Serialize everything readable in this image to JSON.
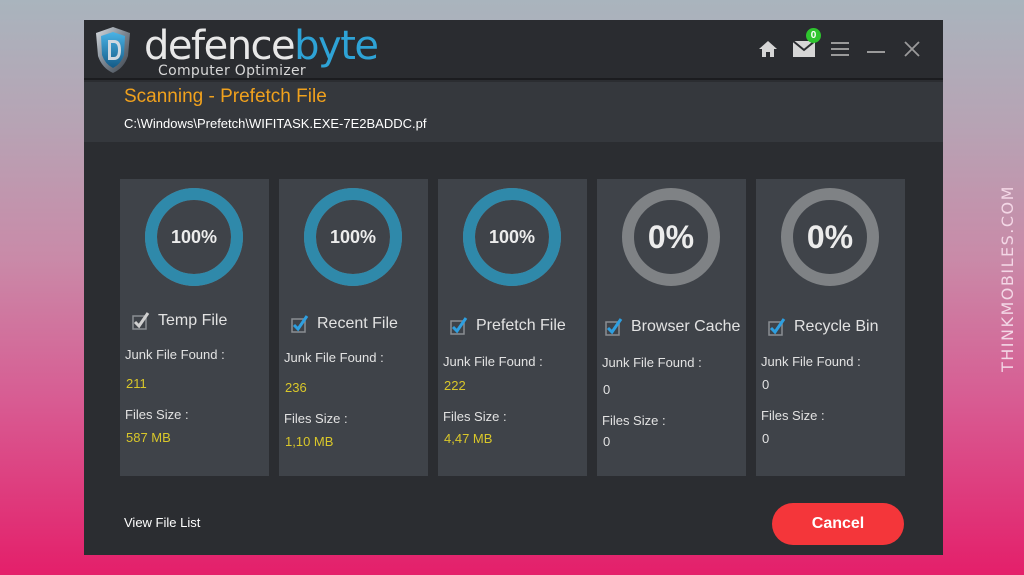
{
  "watermark": "THINKMOBILES.COM",
  "app": {
    "brand_white": "defence",
    "brand_blue": "byte",
    "tagline": "Computer Optimizer",
    "notification_count": "0"
  },
  "titlebar_icons": [
    "home-icon",
    "mail-icon",
    "menu-icon",
    "minimize-icon",
    "close-icon"
  ],
  "scan": {
    "title": "Scanning - Prefetch File",
    "path": "C:\\Windows\\Prefetch\\WIFITASK.EXE-7E2BADDC.pf"
  },
  "labels": {
    "junk_found": "Junk File Found :",
    "files_size": "Files Size :"
  },
  "categories": [
    {
      "name": "Temp File",
      "progress_percent": 100,
      "progress_label": "100%",
      "checked": true,
      "junk_found": "211",
      "files_size": "587 MB"
    },
    {
      "name": "Recent File",
      "progress_percent": 100,
      "progress_label": "100%",
      "checked": true,
      "junk_found": "236",
      "files_size": "1,10 MB"
    },
    {
      "name": "Prefetch File",
      "progress_percent": 100,
      "progress_label": "100%",
      "checked": true,
      "junk_found": "222",
      "files_size": "4,47 MB"
    },
    {
      "name": "Browser Cache",
      "progress_percent": 0,
      "progress_label": "0%",
      "checked": true,
      "junk_found": "0",
      "files_size": "0"
    },
    {
      "name": "Recycle Bin",
      "progress_percent": 0,
      "progress_label": "0%",
      "checked": true,
      "junk_found": "0",
      "files_size": "0"
    }
  ],
  "footer": {
    "view_file_list": "View File List",
    "cancel": "Cancel"
  },
  "colors": {
    "accent_orange": "#f0a11d",
    "ring_complete": "#2f89aa",
    "ring_pending": "#7f8285",
    "value_yellow": "#d9c72a",
    "cancel_red": "#f4363a",
    "badge_green": "#2ec52e"
  }
}
